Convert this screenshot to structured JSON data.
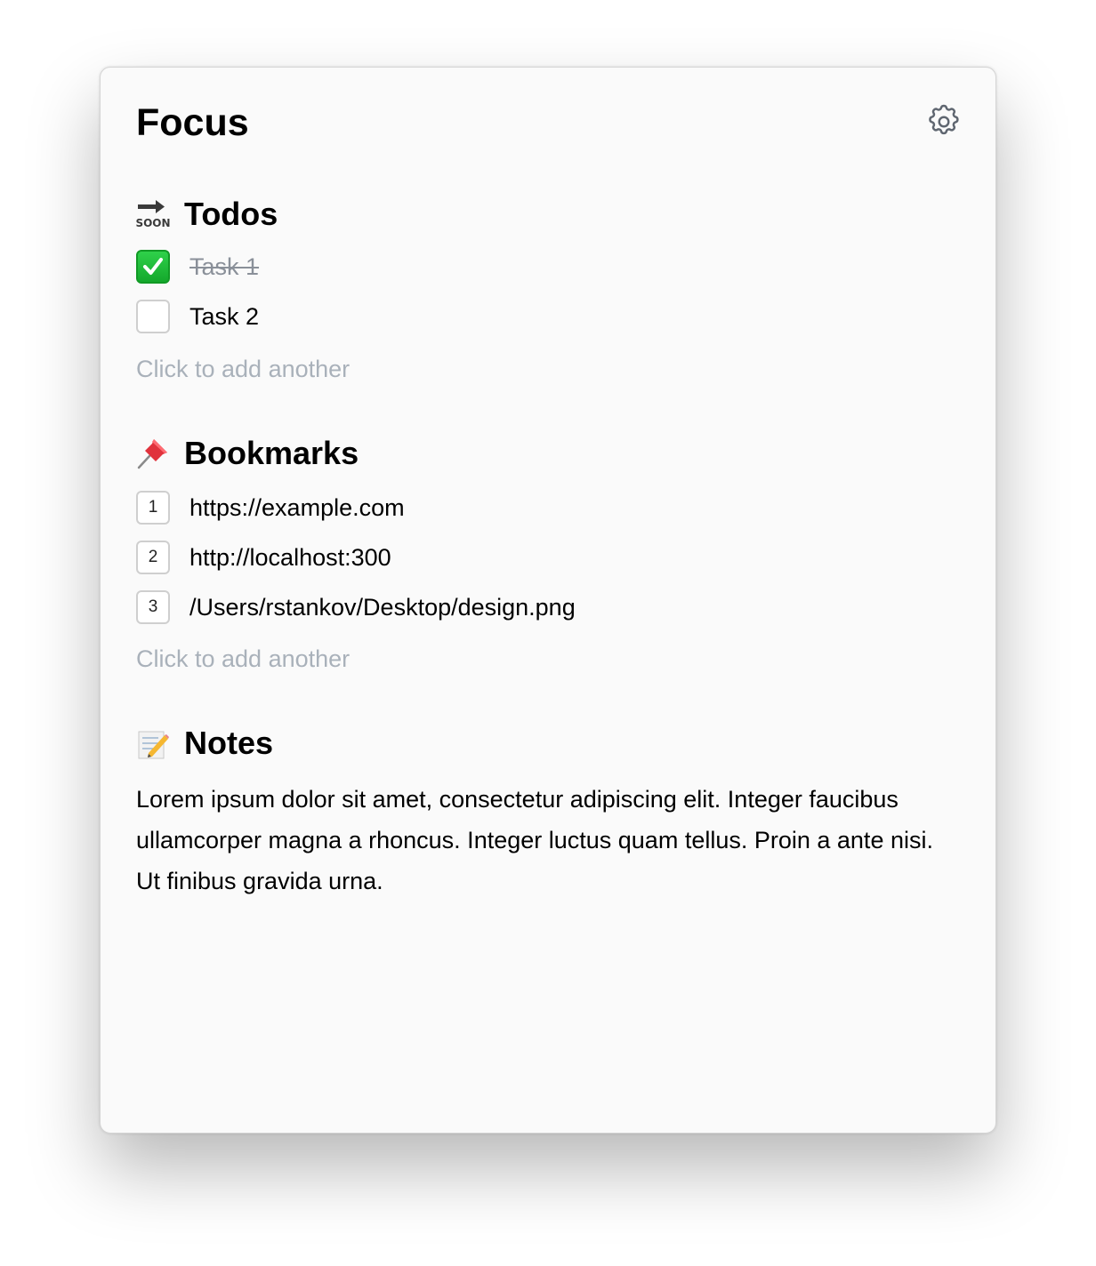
{
  "app": {
    "title": "Focus"
  },
  "todos": {
    "title": "Todos",
    "icon": "soon-arrow-icon",
    "items": [
      {
        "label": "Task 1",
        "done": true
      },
      {
        "label": "Task 2",
        "done": false
      }
    ],
    "add_label": "Click to add another"
  },
  "bookmarks": {
    "title": "Bookmarks",
    "icon": "pushpin-icon",
    "items": [
      {
        "number": "1",
        "url": "https://example.com"
      },
      {
        "number": "2",
        "url": "http://localhost:300"
      },
      {
        "number": "3",
        "url": "/Users/rstankov/Desktop/design.png"
      }
    ],
    "add_label": "Click to add another"
  },
  "notes": {
    "title": "Notes",
    "icon": "memo-icon",
    "body": "Lorem ipsum dolor sit amet, consectetur adipiscing elit. Integer faucibus ullamcorper magna a rhoncus. Integer luctus quam tellus. Proin a ante nisi. Ut finibus gravida urna."
  },
  "colors": {
    "check_green": "#14a82c",
    "placeholder": "#a9b1ba",
    "done_text": "#8a9099"
  }
}
